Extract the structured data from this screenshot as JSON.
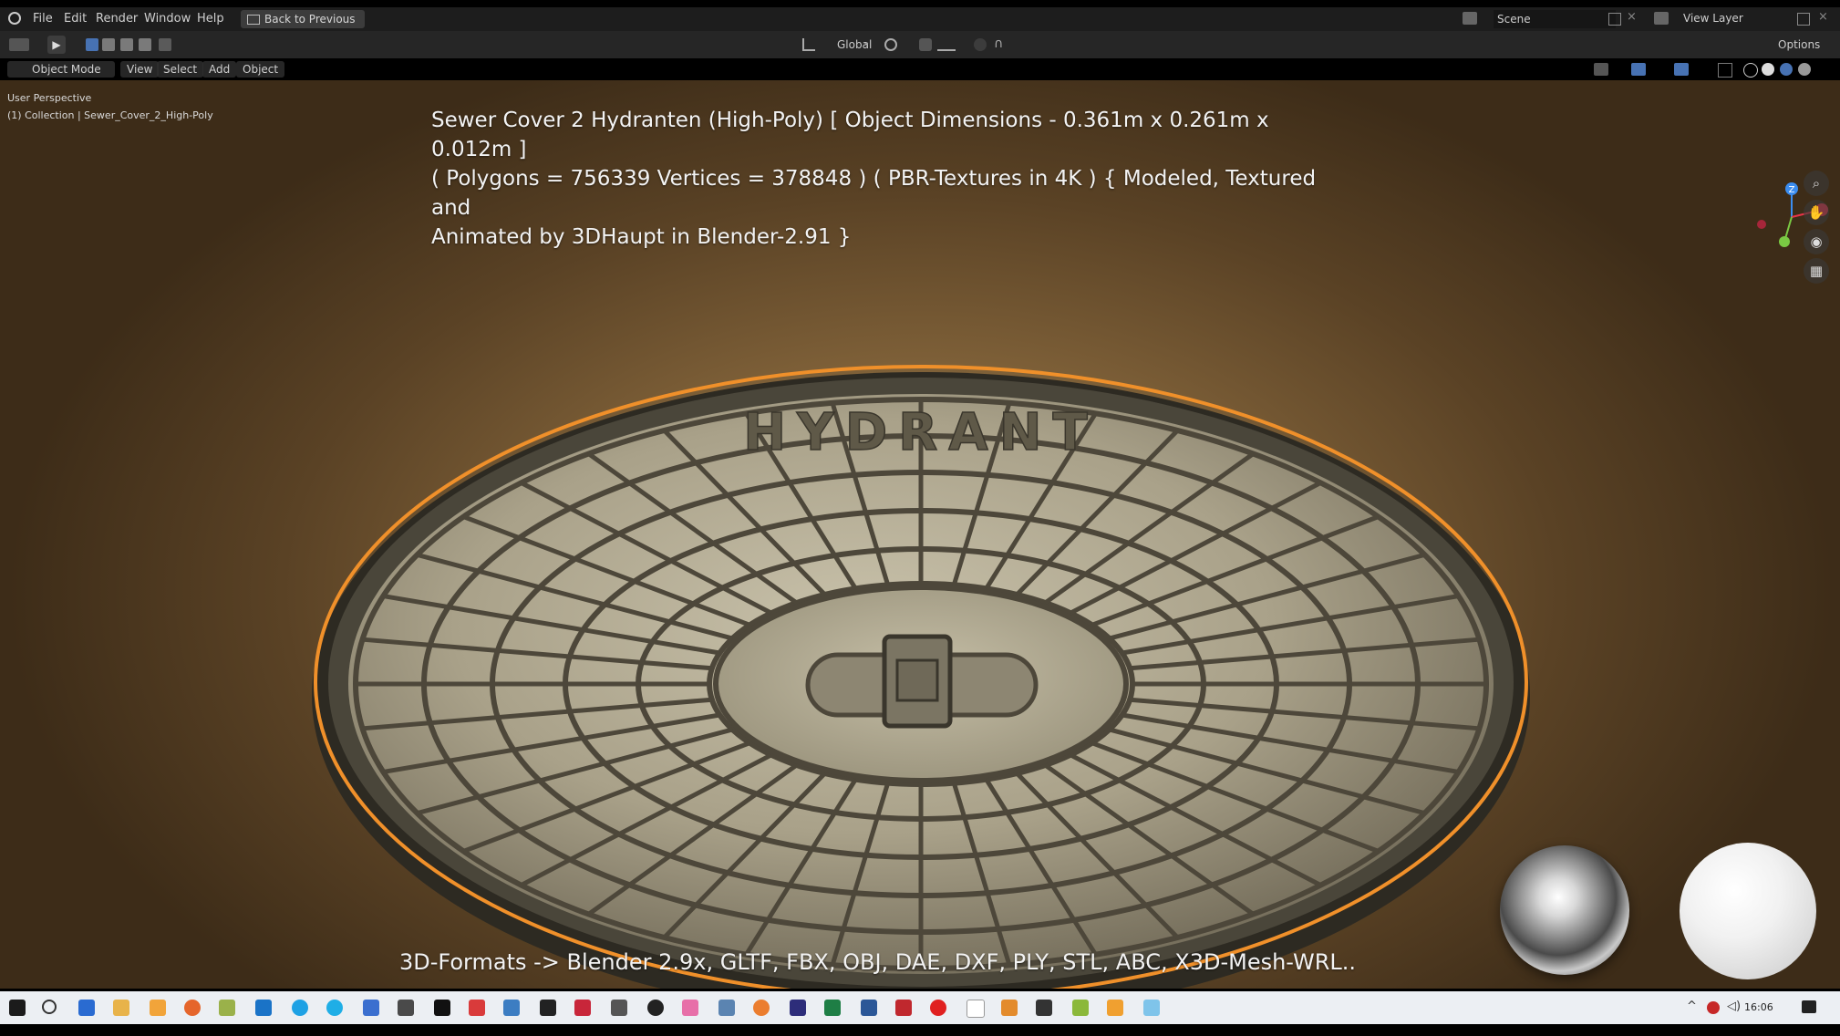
{
  "topbar": {
    "menus": [
      "File",
      "Edit",
      "Render",
      "Window",
      "Help"
    ],
    "back_button": "Back to Previous",
    "scene_label": "Scene",
    "view_layer_label": "View Layer"
  },
  "toolbar": {
    "transform_orientation": "Global",
    "options_label": "Options"
  },
  "viewport_header": {
    "mode": "Object Mode",
    "menus": [
      "View",
      "Select",
      "Add",
      "Object"
    ]
  },
  "viewport_info": {
    "perspective": "User Perspective",
    "collection": "(1) Collection | Sewer_Cover_2_High-Poly"
  },
  "overlay": {
    "title_line1": "Sewer Cover 2 Hydranten (High-Poly) [ Object Dimensions -  0.361m x 0.261m x 0.012m ]",
    "title_line2": "( Polygons = 756339 Vertices = 378848 ) ( PBR-Textures in 4K ) { Modeled, Textured and",
    "title_line3": "Animated by 3DHaupt in Blender-2.91 }",
    "formats": "3D-Formats -> Blender 2.9x, GLTF, FBX, OBJ, DAE, DXF, PLY, STL, ABC, X3D-Mesh-WRL.."
  },
  "model": {
    "embossed_text": "HYDRANT",
    "outline_color": "#f0902a",
    "metal_color": "#a9a189"
  },
  "gizmo": {
    "z_label": "Z",
    "x_color": "#e8344a",
    "y_color": "#7ac943",
    "z_color": "#3b8df0"
  },
  "nav_icons": [
    "zoom-icon",
    "hand-pan-icon",
    "camera-icon",
    "grid-icon"
  ],
  "taskbar": {
    "time": "16:06"
  }
}
